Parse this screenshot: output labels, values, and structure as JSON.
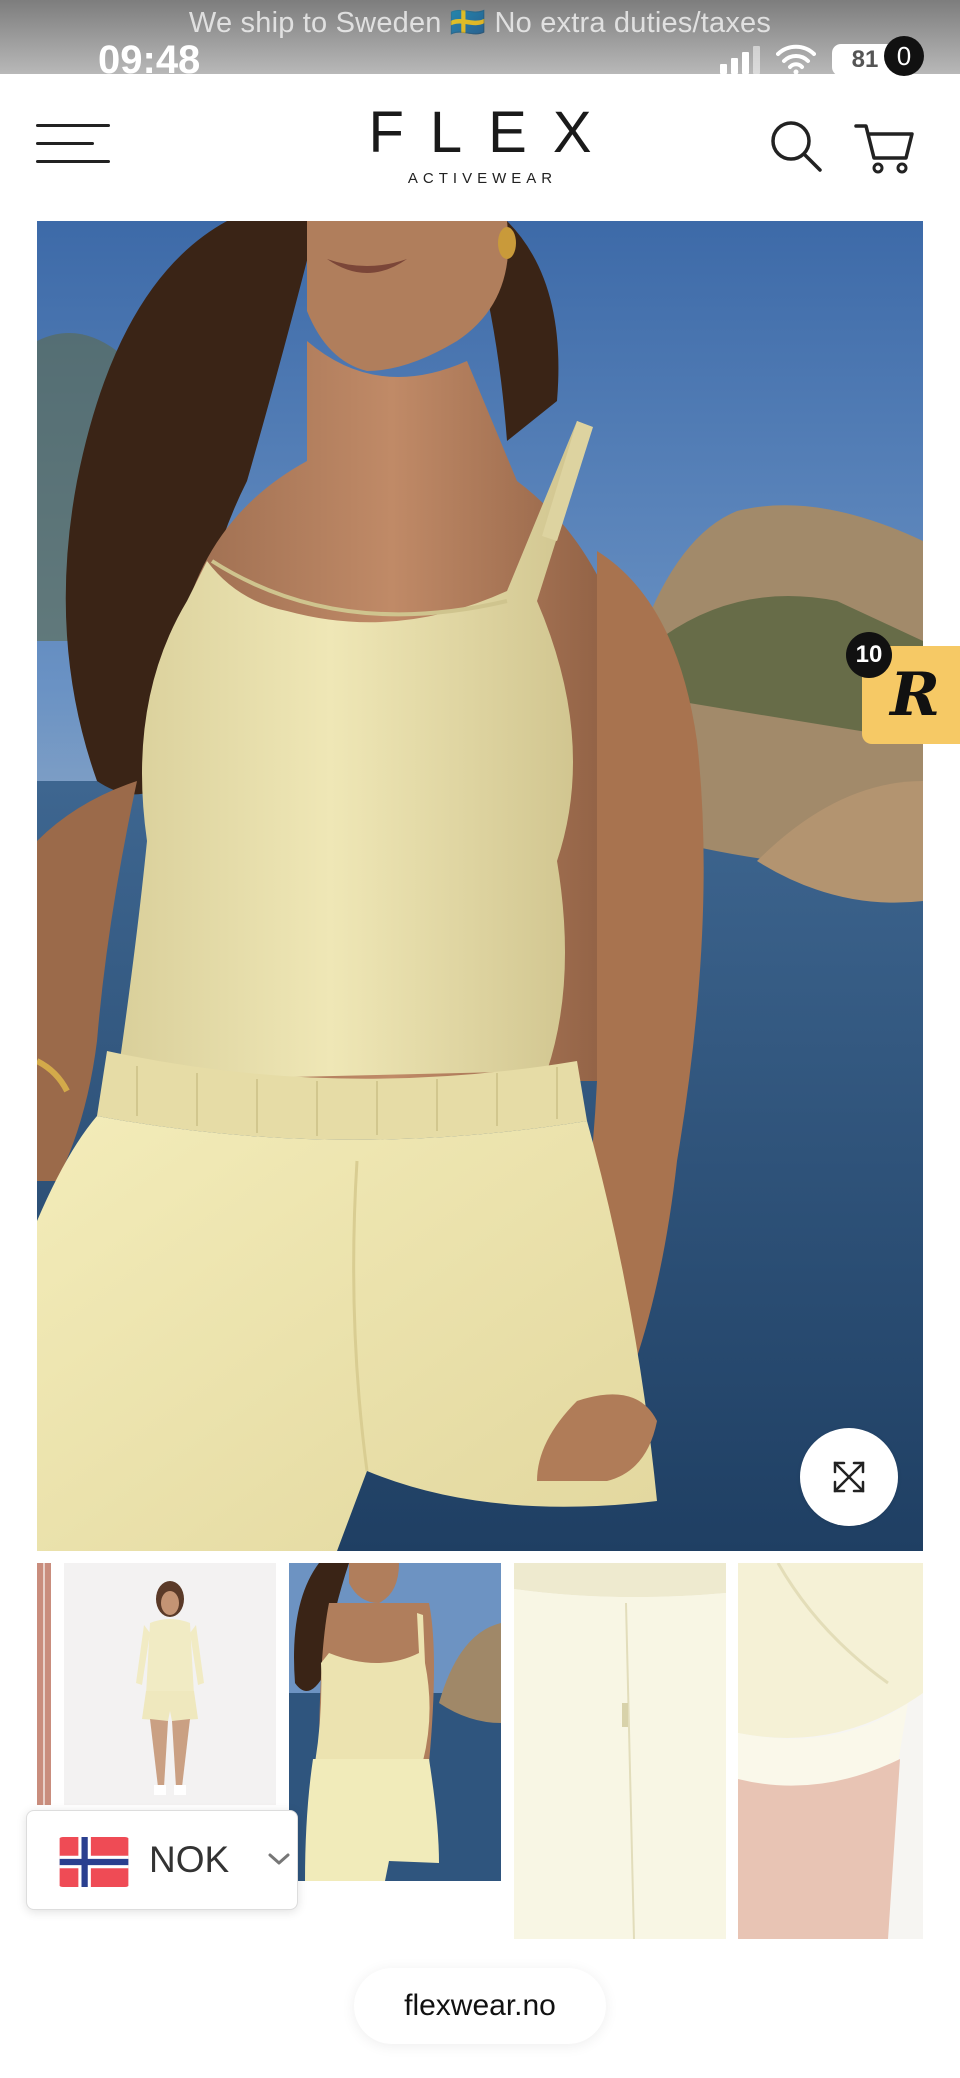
{
  "banner": {
    "text": "We ship to Sweden 🇸🇪 No extra duties/taxes"
  },
  "status_bar": {
    "time": "09:48",
    "battery": "81"
  },
  "header": {
    "logo_main": "FLEX",
    "logo_sub": "ACTIVEWEAR",
    "cart_count": "0",
    "icons": [
      "hamburger-menu-icon",
      "search-icon",
      "cart-icon"
    ]
  },
  "rewards": {
    "count": "10",
    "letter": "R",
    "color": "#f6c965"
  },
  "gallery": {
    "main_image": "model wearing pale yellow tank top and shorts by the sea",
    "thumbnails": [
      "sliver",
      "full-body studio shot",
      "beach shot",
      "shorts side detail",
      "shorts hem detail"
    ]
  },
  "currency": {
    "code": "NOK"
  },
  "url": {
    "text": "flexwear.no"
  },
  "colors": {
    "accent": "#111111",
    "garment": "#efe7b2",
    "sea": "#2e5477"
  }
}
